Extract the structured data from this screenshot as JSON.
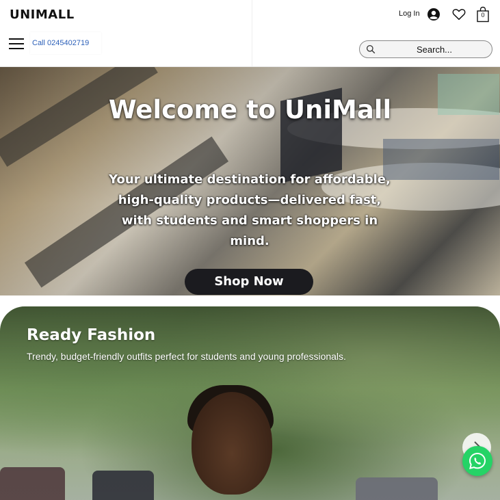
{
  "header": {
    "logo": "UNIMALL",
    "call_label": "Call 0245402719",
    "login_label": "Log In",
    "cart_count": "0",
    "search": {
      "placeholder": "Search..."
    }
  },
  "hero": {
    "title": "Welcome to UniMall",
    "subtitle": "Your ultimate destination for affordable, high-quality products—delivered fast, with students and smart shoppers in mind.",
    "cta_label": "Shop Now"
  },
  "fashion": {
    "title": "Ready Fashion",
    "subtitle": "Trendy, budget-friendly outfits perfect for students and young professionals."
  },
  "icons": {
    "menu": "hamburger-menu-icon",
    "account": "account-avatar-icon",
    "wishlist": "heart-icon",
    "cart": "shopping-bag-icon",
    "search": "search-icon",
    "next": "chevron-right-icon",
    "chat": "whatsapp-icon"
  },
  "colors": {
    "link": "#2b5fb8",
    "cta_bg": "#1b1b1f",
    "whatsapp": "#25d366"
  }
}
